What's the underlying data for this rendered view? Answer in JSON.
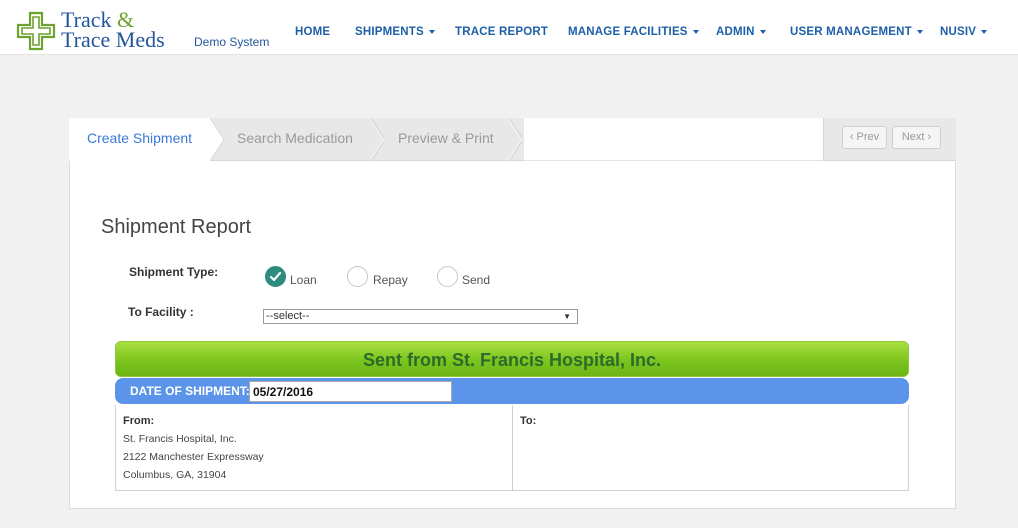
{
  "app": {
    "brand_line1": "Track",
    "brand_amp": "&",
    "brand_line2": "Trace Meds",
    "subtitle": "Demo System"
  },
  "nav": {
    "home": "HOME",
    "shipments": "SHIPMENTS",
    "trace_report": "TRACE REPORT",
    "manage_facilities": "MANAGE FACILITIES",
    "admin": "ADMIN",
    "user_management": "USER MANAGEMENT",
    "nusiv": "NUSIV"
  },
  "wizard": {
    "steps": [
      "Create Shipment",
      "Search Medication",
      "Preview & Print"
    ],
    "active_step": "Create Shipment",
    "prev_label": "Prev",
    "next_label": "Next",
    "prev_icon": "chevron-left-icon",
    "next_icon": "chevron-right-icon"
  },
  "form": {
    "title": "Shipment Report",
    "shipment_type_label": "Shipment Type:",
    "shipment_types": [
      "Loan",
      "Repay",
      "Send"
    ],
    "selected_type": "Loan",
    "to_facility_label": "To Facility :",
    "to_facility_value": "--select--"
  },
  "report": {
    "sent_from": "Sent from St. Francis Hospital, Inc.",
    "date_label": "DATE OF SHIPMENT:",
    "date_value": "05/27/2016",
    "from_label": "From:",
    "from_lines": [
      "St. Francis Hospital, Inc.",
      "2122 Manchester Expressway",
      "Columbus, GA, 31904"
    ],
    "to_label": "To:"
  },
  "colors": {
    "brand_blue": "#23569b",
    "brand_green": "#6ea22f",
    "nav_blue": "#1d5fa8",
    "active_step": "#3a7bd5",
    "radio_checked": "#2e8b7e",
    "green_bar": "#7cc41e",
    "blue_bar": "#5b94e8"
  }
}
